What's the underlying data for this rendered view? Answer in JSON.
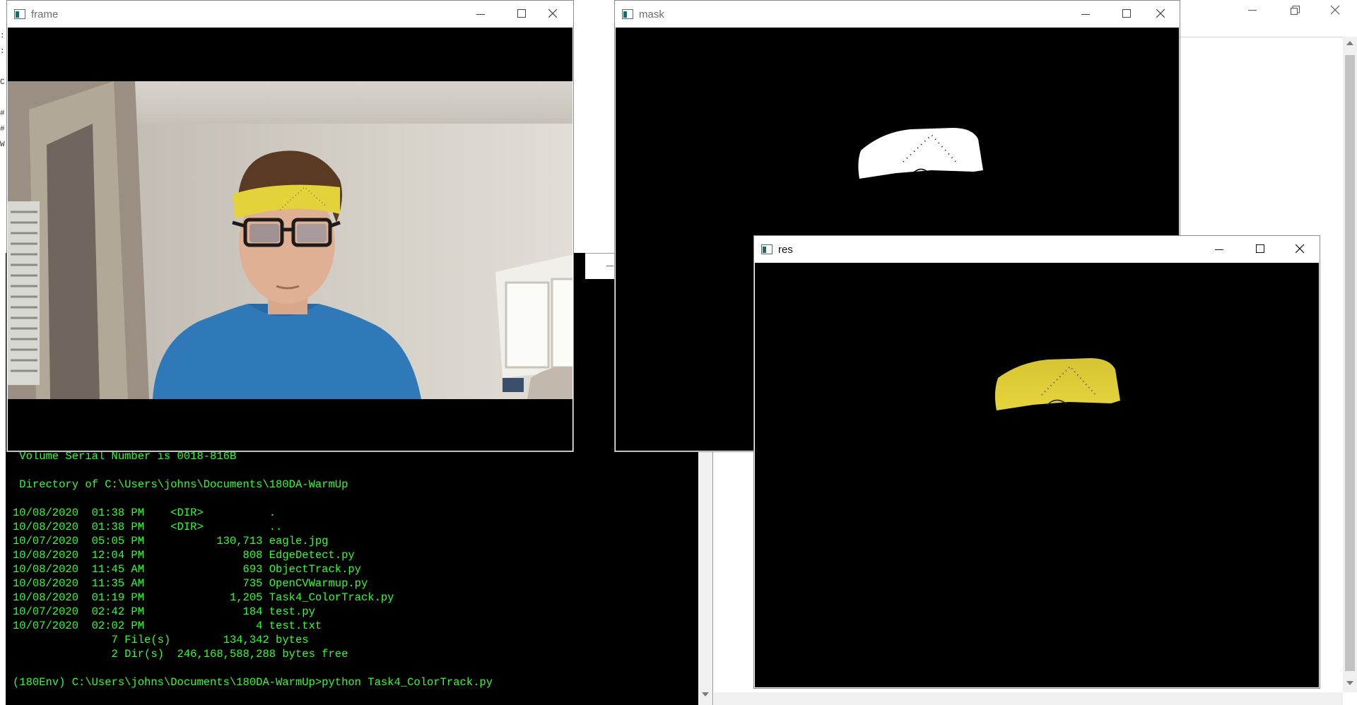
{
  "windows": {
    "frame": {
      "title": "frame"
    },
    "mask": {
      "title": "mask"
    },
    "res": {
      "title": "res"
    }
  },
  "console": {
    "lines": [
      " Volume Serial Number is 0018-816B",
      "",
      " Directory of C:\\Users\\johns\\Documents\\180DA-WarmUp",
      "",
      "10/08/2020  01:38 PM    <DIR>          .",
      "10/08/2020  01:38 PM    <DIR>          ..",
      "10/07/2020  05:05 PM           130,713 eagle.jpg",
      "10/08/2020  12:04 PM               808 EdgeDetect.py",
      "10/08/2020  11:45 AM               693 ObjectTrack.py",
      "10/08/2020  11:35 AM               735 OpenCVWarmup.py",
      "10/08/2020  01:19 PM             1,205 Task4_ColorTrack.py",
      "10/07/2020  02:42 PM               184 test.py",
      "10/07/2020  02:02 PM                 4 test.txt",
      "               7 File(s)        134,342 bytes",
      "               2 Dir(s)  246,168,588,288 bytes free",
      "",
      "(180Env) C:\\Users\\johns\\Documents\\180DA-WarmUp>python Task4_ColorTrack.py"
    ]
  },
  "background_editor": {
    "gutter_chars": [
      ":",
      ":",
      "",
      "C",
      "",
      "#",
      "#",
      "W"
    ]
  },
  "colors": {
    "console_text": "#2bff2b",
    "headband": "#e4d23a",
    "shirt": "#2f79b8"
  },
  "icons": {
    "minimize": "minimize-icon",
    "maximize": "maximize-icon",
    "close": "close-icon",
    "restore": "restore-icon"
  }
}
